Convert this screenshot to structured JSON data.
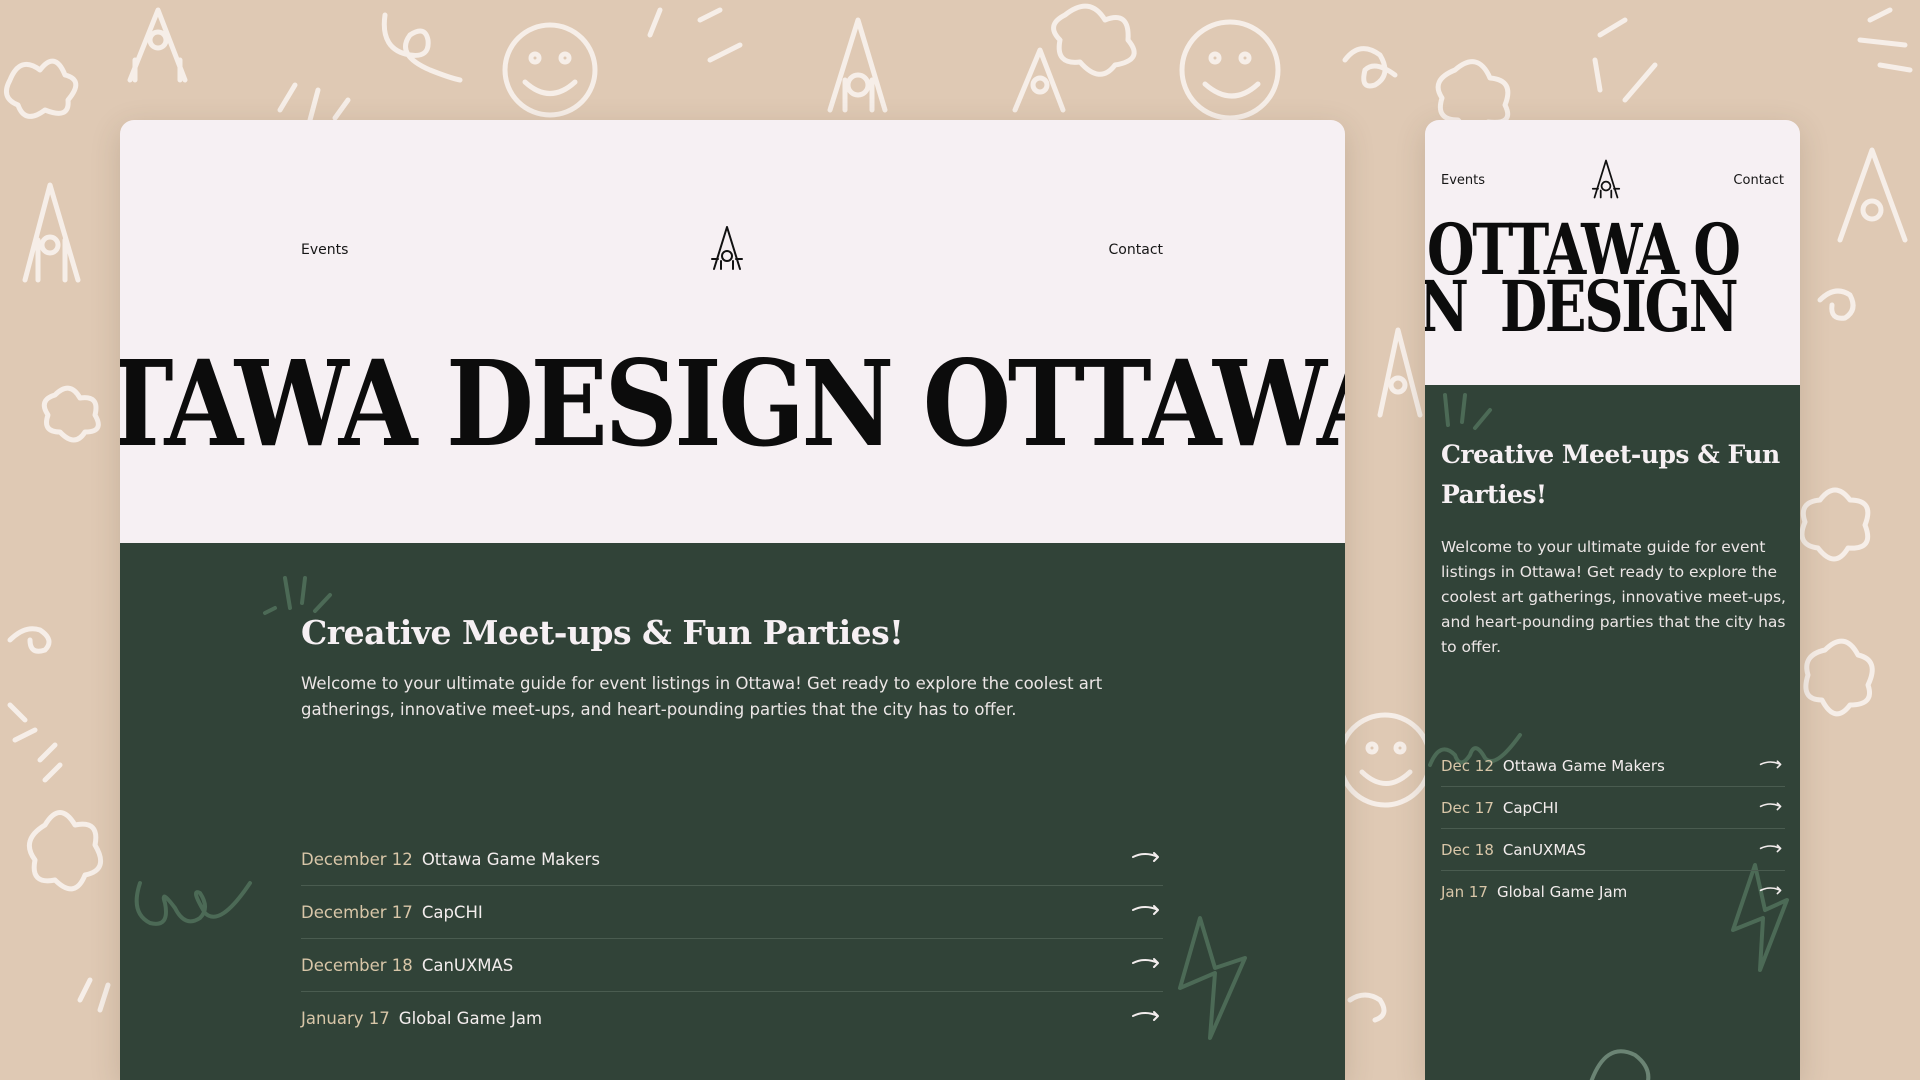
{
  "desktop": {
    "nav": {
      "events": "Events",
      "contact": "Contact"
    },
    "marquee_text": "TAWA DESIGN OTTAWA D",
    "headline": "Creative Meet-ups & Fun Parties!",
    "intro": "Welcome to your ultimate guide for event listings in Ottawa! Get ready to explore the coolest art gatherings, innovative meet-ups, and heart-pounding parties that the city has to offer.",
    "events": [
      {
        "date": "December 12",
        "name": "Ottawa Game Makers"
      },
      {
        "date": "December 17",
        "name": "CapCHI"
      },
      {
        "date": "December 18",
        "name": "CanUXMAS"
      },
      {
        "date": "January 17",
        "name": "Global Game Jam"
      }
    ]
  },
  "mobile": {
    "nav": {
      "events": "Events",
      "contact": "Contact"
    },
    "marquee_line1": "OTTAWA O",
    "marquee_line2": "N  DESIGN",
    "headline": "Creative Meet-ups & Fun Parties!",
    "intro": "Welcome to your ultimate guide for event listings in Ottawa! Get ready to explore the coolest art gatherings, innovative meet-ups, and heart-pounding parties that the city has to offer.",
    "events": [
      {
        "date": "Dec 12",
        "name": "Ottawa Game Makers"
      },
      {
        "date": "Dec 17",
        "name": "CapCHI"
      },
      {
        "date": "Dec 18",
        "name": "CanUXMAS"
      },
      {
        "date": "Jan 17",
        "name": "Global Game Jam"
      }
    ]
  },
  "colors": {
    "background": "#dfc9b4",
    "page": "#f6f0f3",
    "green": "#314338",
    "date_accent": "#d8c6a8"
  }
}
